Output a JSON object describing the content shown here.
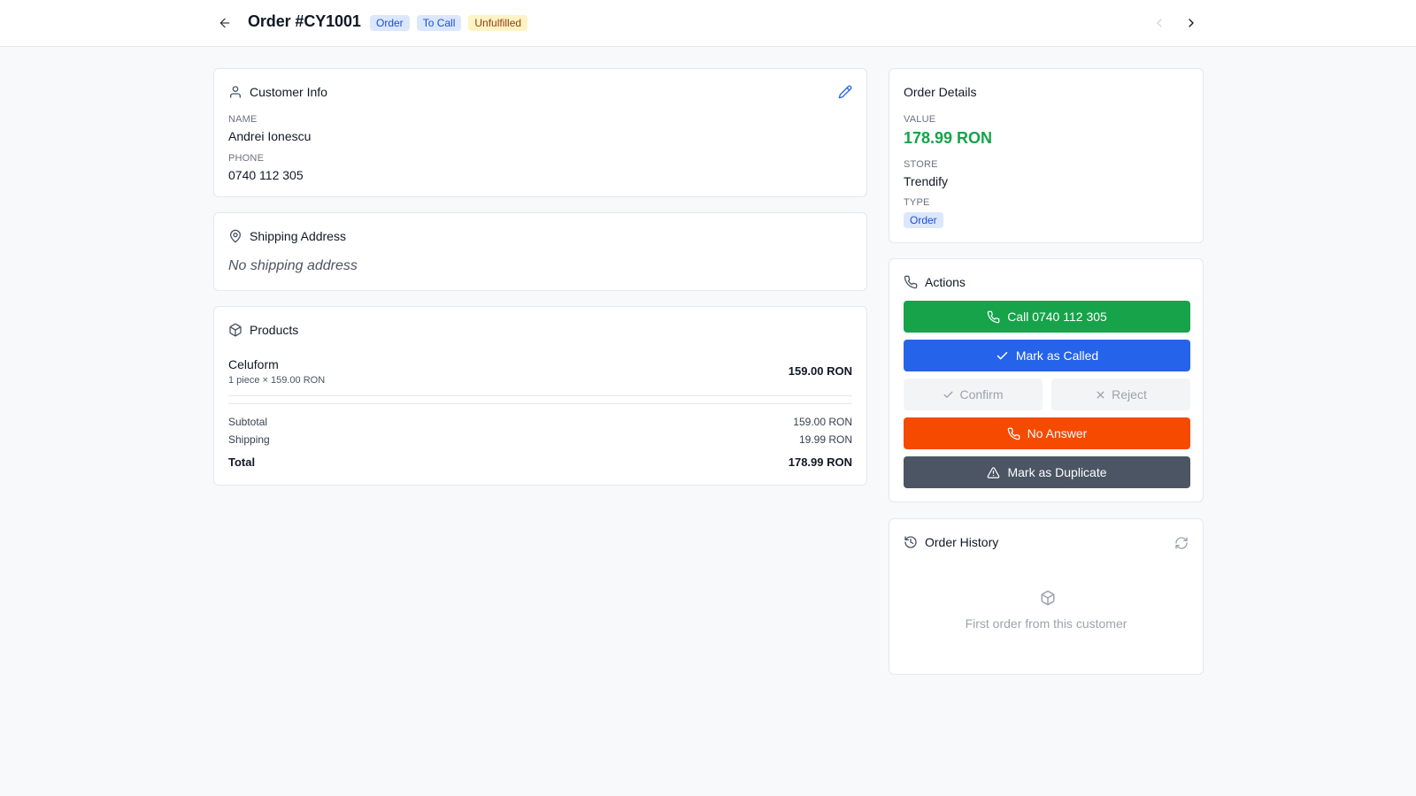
{
  "header": {
    "title": "Order #CY1001",
    "badges": [
      "Order",
      "To Call",
      "Unfulfilled"
    ]
  },
  "customer": {
    "heading": "Customer Info",
    "name_label": "NAME",
    "name": "Andrei Ionescu",
    "phone_label": "PHONE",
    "phone": "0740 112 305"
  },
  "shipping": {
    "heading": "Shipping Address",
    "empty": "No shipping address"
  },
  "products": {
    "heading": "Products",
    "items": [
      {
        "name": "Celuform",
        "detail": "1 piece × 159.00 RON",
        "price": "159.00 RON"
      }
    ],
    "subtotal_label": "Subtotal",
    "subtotal": "159.00 RON",
    "shipping_label": "Shipping",
    "shipping": "19.99 RON",
    "total_label": "Total",
    "total": "178.99 RON"
  },
  "details": {
    "heading": "Order Details",
    "value_label": "VALUE",
    "value": "178.99 RON",
    "store_label": "STORE",
    "store": "Trendify",
    "type_label": "TYPE",
    "type": "Order"
  },
  "actions": {
    "heading": "Actions",
    "call": "Call 0740 112 305",
    "mark_called": "Mark as Called",
    "confirm": "Confirm",
    "reject": "Reject",
    "no_answer": "No Answer",
    "duplicate": "Mark as Duplicate"
  },
  "history": {
    "heading": "Order History",
    "empty": "First order from this customer"
  },
  "colors": {
    "accent": "#2563eb",
    "success": "#16a34a",
    "warning_bg": "#fdf3c4",
    "danger_orange": "#f54a00",
    "slate": "#4b5563",
    "page_bg": "#f8f9fb"
  },
  "icons": [
    "arrow-left-icon",
    "chevron-left-icon",
    "chevron-right-icon",
    "user-icon",
    "pencil-icon",
    "map-pin-icon",
    "package-icon",
    "phone-icon",
    "check-icon",
    "x-icon",
    "alert-triangle-icon",
    "history-icon",
    "refresh-icon"
  ]
}
